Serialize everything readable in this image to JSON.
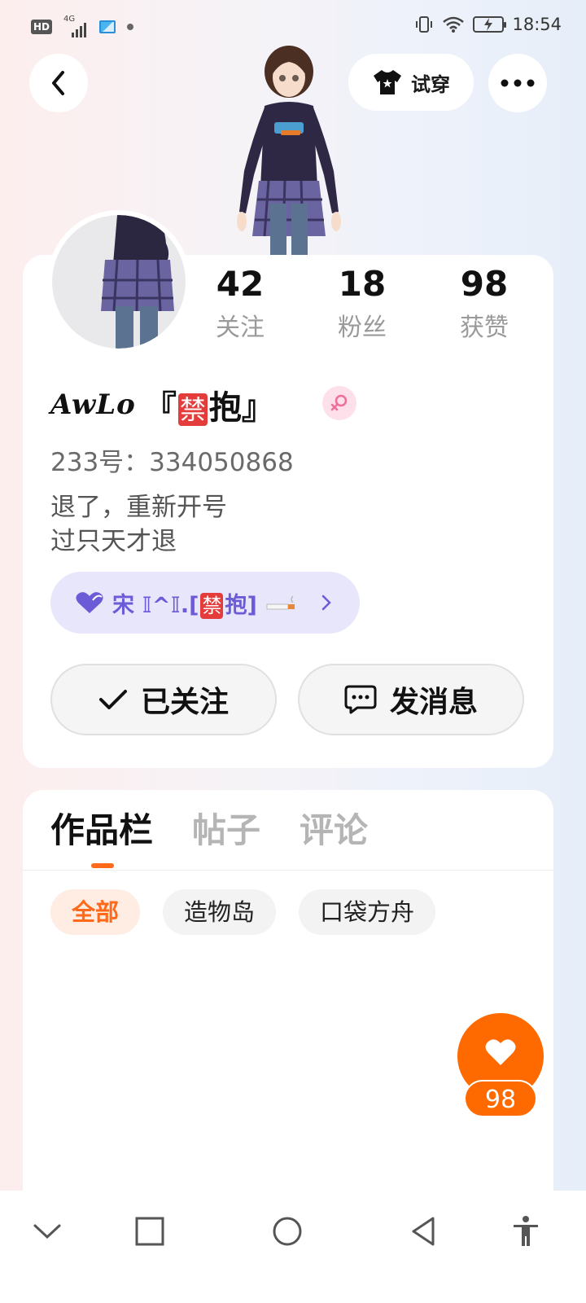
{
  "status_bar": {
    "hd": "HD",
    "network": "4G",
    "time": "18:54"
  },
  "header": {
    "try_on_label": "试穿"
  },
  "profile": {
    "stats": [
      {
        "value": "42",
        "label": "关注"
      },
      {
        "value": "18",
        "label": "粉丝"
      },
      {
        "value": "98",
        "label": "获赞"
      }
    ],
    "nickname_script": "AwLo",
    "nickname_open": "『",
    "nickname_ban": "禁",
    "nickname_rest": "抱』",
    "uid": "233号：334050868",
    "bio_lines": [
      "退了，重新开号",
      "过只天才退"
    ],
    "guild": {
      "prefix": "宋 𝕀^𝕀.[",
      "ban": "禁",
      "suffix": "抱]"
    },
    "follow_label": "已关注",
    "message_label": "发消息"
  },
  "tabs": [
    "作品栏",
    "帖子",
    "评论"
  ],
  "filter_chips": [
    "全部",
    "造物岛",
    "口袋方舟"
  ],
  "like_count": "98",
  "colors": {
    "accent": "#ff6a00",
    "guild_text": "#6b5bd6",
    "guild_bg": "#e8e6fb"
  }
}
